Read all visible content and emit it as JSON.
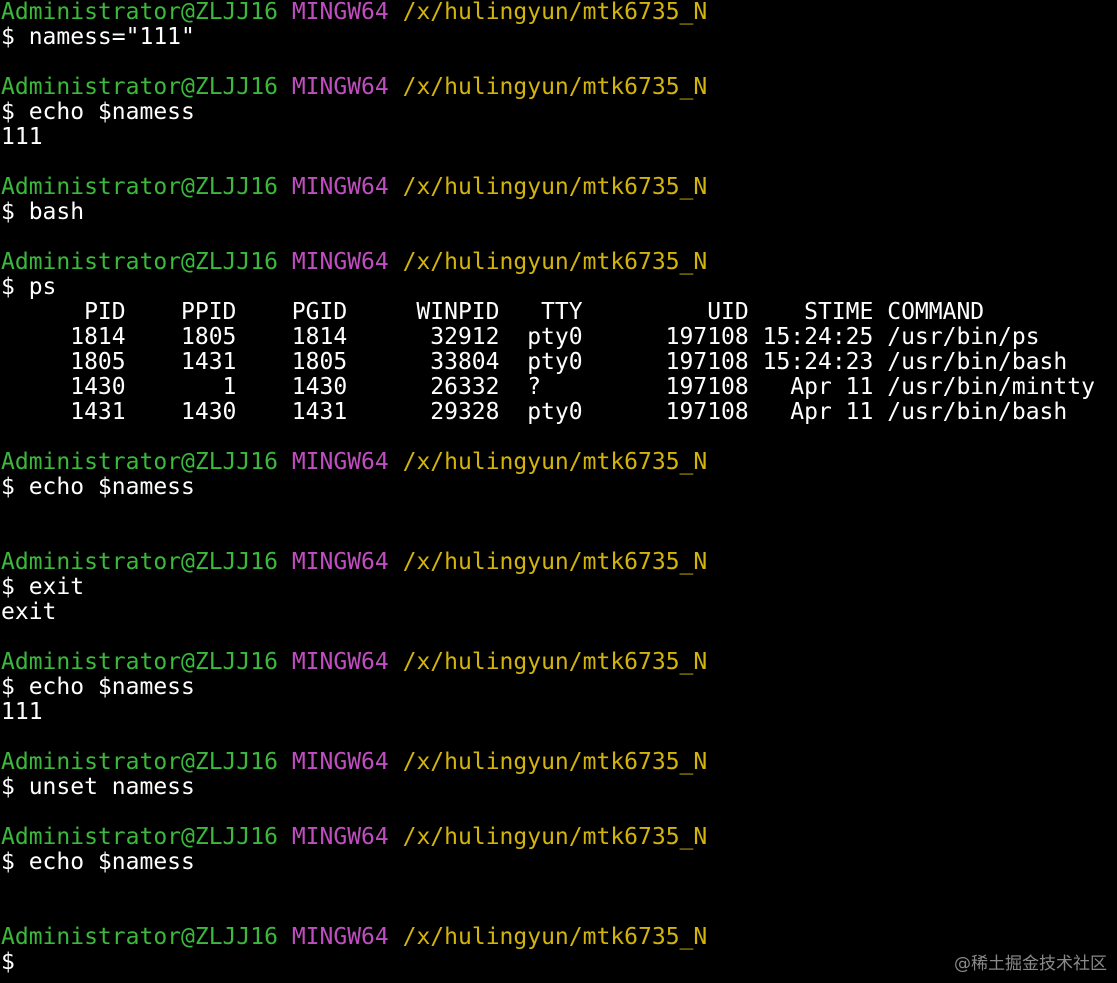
{
  "terminal": {
    "prompt_user": "Administrator@ZLJJ16",
    "prompt_tag": "MINGW64",
    "prompt_path": "/x/hulingyun/mtk6735_N"
  },
  "lines": [
    {
      "type": "prompt"
    },
    {
      "type": "text",
      "text": "$ namess=\"111\""
    },
    {
      "type": "text",
      "text": ""
    },
    {
      "type": "prompt"
    },
    {
      "type": "text",
      "text": "$ echo $namess"
    },
    {
      "type": "text",
      "text": "111"
    },
    {
      "type": "text",
      "text": ""
    },
    {
      "type": "prompt"
    },
    {
      "type": "text",
      "text": "$ bash"
    },
    {
      "type": "text",
      "text": ""
    },
    {
      "type": "prompt"
    },
    {
      "type": "text",
      "text": "$ ps"
    },
    {
      "type": "text",
      "text": "      PID    PPID    PGID     WINPID   TTY         UID    STIME COMMAND"
    },
    {
      "type": "text",
      "text": "     1814    1805    1814      32912  pty0      197108 15:24:25 /usr/bin/ps"
    },
    {
      "type": "text",
      "text": "     1805    1431    1805      33804  pty0      197108 15:24:23 /usr/bin/bash"
    },
    {
      "type": "text",
      "text": "     1430       1    1430      26332  ?         197108   Apr 11 /usr/bin/mintty"
    },
    {
      "type": "text",
      "text": "     1431    1430    1431      29328  pty0      197108   Apr 11 /usr/bin/bash"
    },
    {
      "type": "text",
      "text": ""
    },
    {
      "type": "prompt"
    },
    {
      "type": "text",
      "text": "$ echo $namess"
    },
    {
      "type": "text",
      "text": ""
    },
    {
      "type": "text",
      "text": ""
    },
    {
      "type": "prompt"
    },
    {
      "type": "text",
      "text": "$ exit"
    },
    {
      "type": "text",
      "text": "exit"
    },
    {
      "type": "text",
      "text": ""
    },
    {
      "type": "prompt"
    },
    {
      "type": "text",
      "text": "$ echo $namess"
    },
    {
      "type": "text",
      "text": "111"
    },
    {
      "type": "text",
      "text": ""
    },
    {
      "type": "prompt"
    },
    {
      "type": "text",
      "text": "$ unset namess"
    },
    {
      "type": "text",
      "text": ""
    },
    {
      "type": "prompt"
    },
    {
      "type": "text",
      "text": "$ echo $namess"
    },
    {
      "type": "text",
      "text": ""
    },
    {
      "type": "text",
      "text": ""
    },
    {
      "type": "prompt"
    },
    {
      "type": "text",
      "text": "$"
    }
  ],
  "watermark": "@稀土掘金技术社区",
  "colors": {
    "background": "#000000",
    "user": "#3cb83c",
    "tag": "#c04ec0",
    "path": "#d2b40c",
    "text": "#ffffff"
  }
}
